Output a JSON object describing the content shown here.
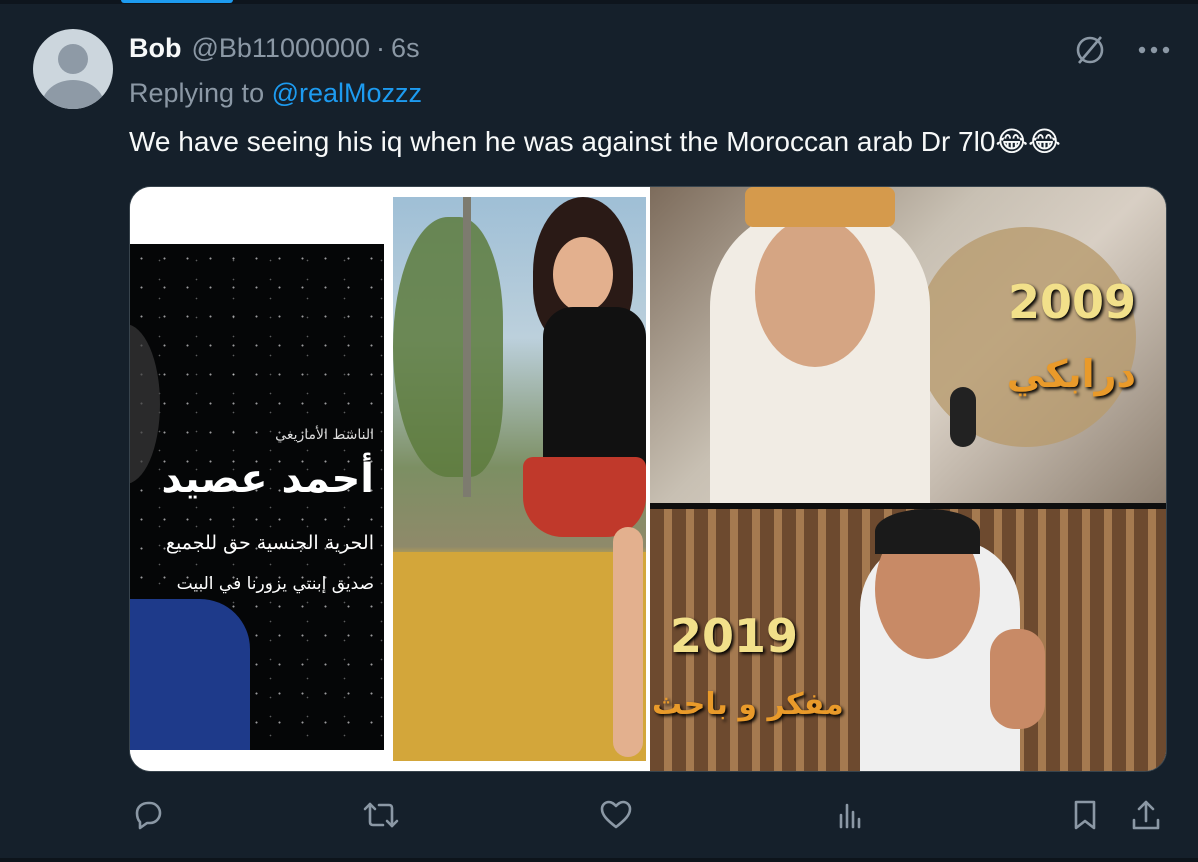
{
  "tweet": {
    "author_name": "Bob",
    "author_handle": "@Bb11000000",
    "separator": "·",
    "timestamp": "6s",
    "replying_prefix": "Replying to ",
    "replying_to": "@realMozzz",
    "text": "We have seeing his iq when he was against the Moroccan  arab Dr 7l0😂😂"
  },
  "media": {
    "left_image": {
      "line1": "الناشط الأمازيغي",
      "line2": "أحمد عصيد",
      "line3": "الحرية الجنسية حق للجميع",
      "line4": "صديق إبنتي يزورنا في البيت"
    },
    "right_top": {
      "year": "2009",
      "caption": "درابكي"
    },
    "right_bottom": {
      "year": "2019",
      "caption": "مفكر و باحث"
    }
  },
  "icons": {
    "grok": "slash-circle-icon",
    "more": "more-horizontal-icon",
    "reply": "reply-icon",
    "repost": "repost-icon",
    "like": "heart-icon",
    "views": "analytics-icon",
    "bookmark": "bookmark-icon",
    "share": "share-icon"
  },
  "colors": {
    "background": "#15202b",
    "primary_text": "#f7f9f9",
    "secondary_text": "#8b98a5",
    "accent": "#1d9bf0"
  }
}
